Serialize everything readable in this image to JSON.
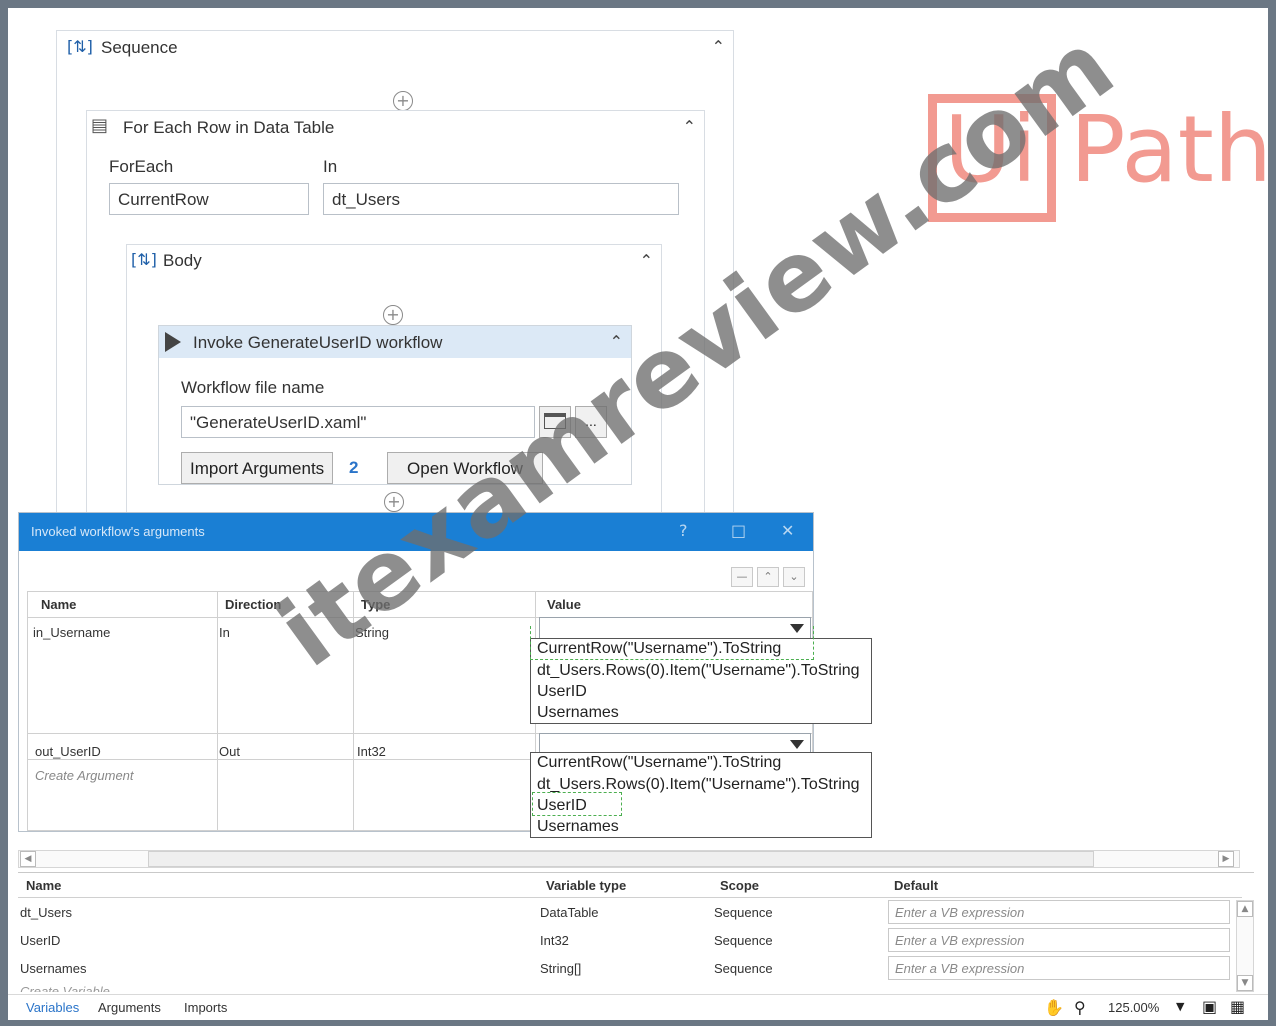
{
  "sequence": {
    "title": "Sequence"
  },
  "foreach": {
    "title": "For Each Row in Data Table",
    "foreach_label": "ForEach",
    "in_label": "In",
    "item_value": "CurrentRow",
    "collection_value": "dt_Users"
  },
  "body": {
    "title": "Body"
  },
  "invoke": {
    "title": "Invoke GenerateUserID workflow",
    "file_label": "Workflow file name",
    "file_value": "\"GenerateUserID.xaml\"",
    "browse_label": "...",
    "import_label": "Import Arguments",
    "import_count": "2",
    "open_label": "Open Workflow"
  },
  "logo": {
    "left": "Ui",
    "right": "Path"
  },
  "dialog": {
    "title": "Invoked workflow's arguments",
    "help": "?",
    "maximize": "□",
    "close": "✕",
    "columns": [
      "Name",
      "Direction",
      "Type",
      "Value"
    ],
    "rows": [
      {
        "name": "in_Username",
        "direction": "In",
        "type": "String"
      },
      {
        "name": "out_UserID",
        "direction": "Out",
        "type": "Int32"
      }
    ],
    "create_argument": "Create Argument",
    "options": [
      "CurrentRow(\"Username\").ToString",
      "dt_Users.Rows(0).Item(\"Username\").ToString",
      "UserID",
      "Usernames"
    ]
  },
  "variables": {
    "columns": [
      "Name",
      "Variable type",
      "Scope",
      "Default"
    ],
    "rows": [
      {
        "name": "dt_Users",
        "type": "DataTable",
        "scope": "Sequence",
        "default": "Enter a VB expression"
      },
      {
        "name": "UserID",
        "type": "Int32",
        "scope": "Sequence",
        "default": "Enter a VB expression"
      },
      {
        "name": "Usernames",
        "type": "String[]",
        "scope": "Sequence",
        "default": "Enter a VB expression"
      }
    ],
    "create_variable": "Create Variable"
  },
  "statusbar": {
    "tabs": [
      "Variables",
      "Arguments",
      "Imports"
    ],
    "zoom": "125.00%"
  },
  "watermark": "itexamreview.com",
  "colors": {
    "accent": "#1a7fd4",
    "logo": "#f29a91",
    "dashed_highlight": "#4caf50"
  }
}
